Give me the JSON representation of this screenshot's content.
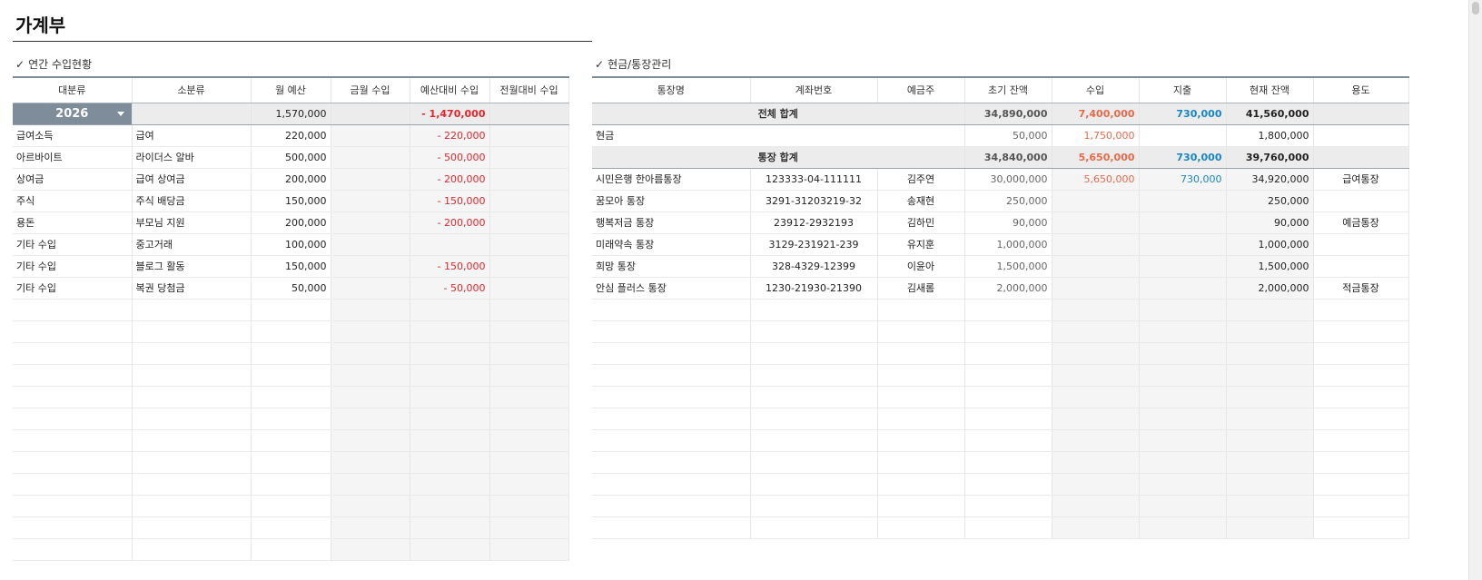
{
  "page": {
    "title": "가계부"
  },
  "income": {
    "section_title": "연간 수입현황",
    "columns": [
      "대분류",
      "소분류",
      "월 예산",
      "금월 수입",
      "예산대비 수입",
      "전월대비 수입"
    ],
    "summary": {
      "year": "2026",
      "budget": "1,570,000",
      "diff": "- 1,470,000"
    },
    "rows": [
      {
        "major": "급여소득",
        "minor": "급여",
        "budget": "220,000",
        "diff": "- 220,000"
      },
      {
        "major": "아르바이트",
        "minor": "라이더스 알바",
        "budget": "500,000",
        "diff": "- 500,000"
      },
      {
        "major": "상여금",
        "minor": "급여 상여금",
        "budget": "200,000",
        "diff": "- 200,000"
      },
      {
        "major": "주식",
        "minor": "주식 배당금",
        "budget": "150,000",
        "diff": "- 150,000"
      },
      {
        "major": "용돈",
        "minor": "부모님 지원",
        "budget": "200,000",
        "diff": "- 200,000"
      },
      {
        "major": "기타 수입",
        "minor": "중고거래",
        "budget": "100,000",
        "diff": ""
      },
      {
        "major": "기타 수입",
        "minor": "블로그 활동",
        "budget": "150,000",
        "diff": "- 150,000"
      },
      {
        "major": "기타 수입",
        "minor": "복권 당첨금",
        "budget": "50,000",
        "diff": "- 50,000"
      }
    ]
  },
  "accounts": {
    "section_title": "현금/통장관리",
    "columns": [
      "통장명",
      "계좌번호",
      "예금주",
      "초기 잔액",
      "수입",
      "지출",
      "현재 잔액",
      "용도"
    ],
    "total": {
      "label": "전체 합계",
      "initial": "34,890,000",
      "income": "7,400,000",
      "expense": "730,000",
      "current": "41,560,000"
    },
    "cash": {
      "label": "현금",
      "initial": "50,000",
      "income": "1,750,000",
      "current": "1,800,000"
    },
    "bank_total": {
      "label": "통장 합계",
      "initial": "34,840,000",
      "income": "5,650,000",
      "expense": "730,000",
      "current": "39,760,000"
    },
    "rows": [
      {
        "name": "시민은행 한아름통장",
        "number": "123333-04-111111",
        "owner": "김주연",
        "initial": "30,000,000",
        "income": "5,650,000",
        "expense": "730,000",
        "current": "34,920,000",
        "use": "급여통장"
      },
      {
        "name": "꿈모아 통장",
        "number": "3291-31203219-32",
        "owner": "송재현",
        "initial": "250,000",
        "income": "",
        "expense": "",
        "current": "250,000",
        "use": ""
      },
      {
        "name": "행복저금 통장",
        "number": "23912-2932193",
        "owner": "김하민",
        "initial": "90,000",
        "income": "",
        "expense": "",
        "current": "90,000",
        "use": "예금통장"
      },
      {
        "name": "미래약속 통장",
        "number": "3129-231921-239",
        "owner": "유지훈",
        "initial": "1,000,000",
        "income": "",
        "expense": "",
        "current": "1,000,000",
        "use": ""
      },
      {
        "name": "희망 통장",
        "number": "328-4329-12399",
        "owner": "이윤아",
        "initial": "1,500,000",
        "income": "",
        "expense": "",
        "current": "1,500,000",
        "use": ""
      },
      {
        "name": "안심 플러스 통장",
        "number": "1230-21930-21390",
        "owner": "김새롬",
        "initial": "2,000,000",
        "income": "",
        "expense": "",
        "current": "2,000,000",
        "use": "적금통장"
      }
    ]
  }
}
